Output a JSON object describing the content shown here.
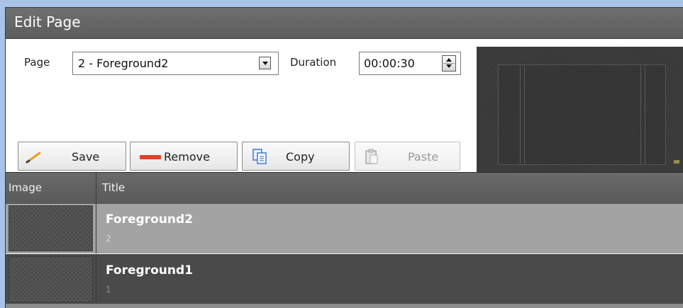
{
  "window": {
    "title": "Edit Page"
  },
  "form": {
    "page_label": "Page",
    "page_value": "2 - Foreground2",
    "duration_label": "Duration",
    "duration_value": "00:00:30"
  },
  "toolbar": {
    "save": "Save",
    "remove": "Remove",
    "copy": "Copy",
    "paste": "Paste"
  },
  "grid": {
    "columns": [
      "Image",
      "Title"
    ],
    "rows": [
      {
        "title": "Foreground2",
        "subtitle": "2",
        "selected": true
      },
      {
        "title": "Foreground1",
        "subtitle": "1",
        "selected": false
      }
    ]
  },
  "colors": {
    "background": "#a9c3e6",
    "titlebar": "#666666",
    "selected_row": "#a3a3a3",
    "row": "#4a4a4a",
    "remove_icon": "#e0412c",
    "save_icon": "#e8a020",
    "copy_icon": "#3a7bd5"
  }
}
